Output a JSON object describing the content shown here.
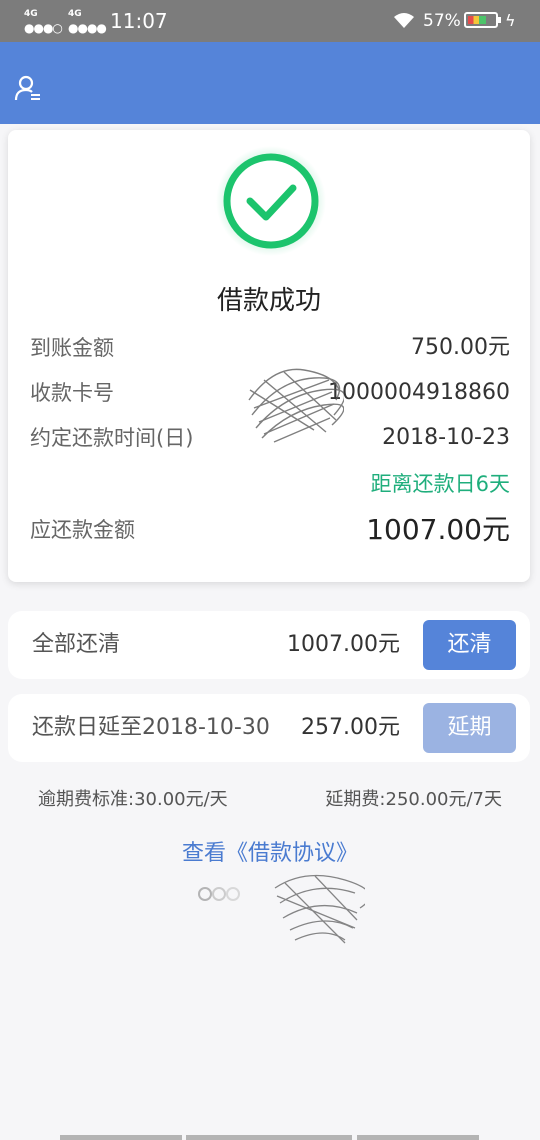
{
  "status_bar": {
    "network1": "4G",
    "network2": "4G",
    "time": "11:07",
    "battery_percent": "57%",
    "battery_level": 0.57
  },
  "header": {
    "icon": "user-menu-icon"
  },
  "card": {
    "title": "借款成功",
    "rows": [
      {
        "label": "到账金额",
        "value": "750.00元"
      },
      {
        "label": "收款卡号",
        "value": "1000004918860"
      },
      {
        "label": "约定还款时间(日)",
        "value": "2018-10-23"
      }
    ],
    "countdown": "距离还款日6天",
    "due": {
      "label": "应还款金额",
      "value": "1007.00元"
    }
  },
  "repay_all": {
    "label": "全部还清",
    "amount": "1007.00元",
    "button": "还清"
  },
  "extend": {
    "label": "还款日延至2018-10-30",
    "amount": "257.00元",
    "button": "延期"
  },
  "fees": {
    "overdue": "逾期费标准:30.00元/天",
    "extension": "延期费:250.00元/7天"
  },
  "agreement_link": "查看《借款协议》",
  "colors": {
    "primary": "#5584d9",
    "success": "#1fae7c",
    "disabled": "#9bb3e2"
  }
}
